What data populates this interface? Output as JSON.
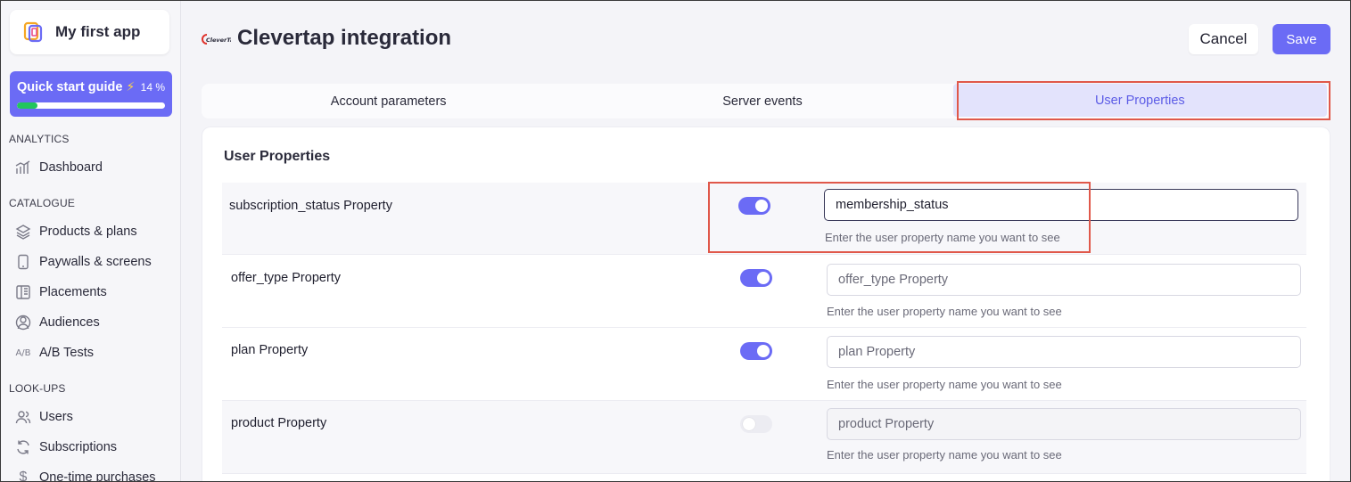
{
  "sidebar": {
    "app_name": "My first app",
    "quick_start": {
      "title": "Quick start guide",
      "percent_label": "14 %",
      "progress": 0.14
    },
    "sections": [
      {
        "label": "ANALYTICS",
        "items": [
          {
            "label": "Dashboard",
            "icon": "chart-icon"
          }
        ]
      },
      {
        "label": "CATALOGUE",
        "items": [
          {
            "label": "Products & plans",
            "icon": "layers-icon"
          },
          {
            "label": "Paywalls & screens",
            "icon": "phone-icon"
          },
          {
            "label": "Placements",
            "icon": "placements-icon"
          },
          {
            "label": "Audiences",
            "icon": "audience-icon"
          },
          {
            "label": "A/B Tests",
            "icon": "ab-icon"
          }
        ]
      },
      {
        "label": "LOOK-UPS",
        "items": [
          {
            "label": "Users",
            "icon": "users-icon"
          },
          {
            "label": "Subscriptions",
            "icon": "refresh-icon"
          },
          {
            "label": "One-time purchases",
            "icon": "dollar-icon"
          }
        ]
      }
    ]
  },
  "header": {
    "title": "Clevertap integration",
    "logo_text": "CleverTap",
    "cancel_label": "Cancel",
    "save_label": "Save"
  },
  "tabs": [
    {
      "label": "Account parameters",
      "active": false
    },
    {
      "label": "Server events",
      "active": false
    },
    {
      "label": "User Properties",
      "active": true
    }
  ],
  "panel": {
    "title": "User Properties",
    "rows": [
      {
        "label": "subscription_status Property",
        "enabled": true,
        "value": "membership_status",
        "placeholder": "",
        "hint": "Enter the user property name you want to see"
      },
      {
        "label": "offer_type Property",
        "enabled": true,
        "value": "",
        "placeholder": "offer_type Property",
        "hint": "Enter the user property name you want to see"
      },
      {
        "label": "plan Property",
        "enabled": true,
        "value": "",
        "placeholder": "plan Property",
        "hint": "Enter the user property name you want to see"
      },
      {
        "label": "product Property",
        "enabled": false,
        "value": "",
        "placeholder": "product Property",
        "hint": "Enter the user property name you want to see"
      }
    ]
  },
  "colors": {
    "accent": "#6b6bf5",
    "highlight": "#e0584a",
    "progress": "#22c55e",
    "active_tab_bg": "#e3e3fc"
  }
}
